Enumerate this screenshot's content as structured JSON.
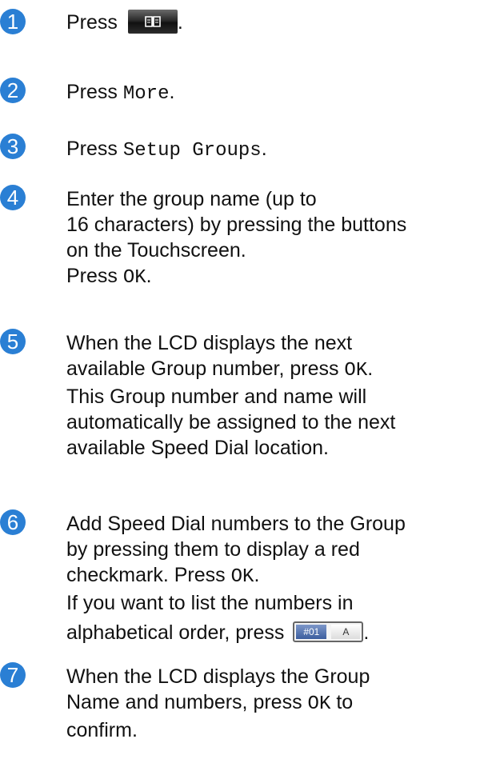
{
  "accent_color": "#2a7fd4",
  "steps": [
    {
      "number": "1",
      "press": "Press",
      "suffix": ".",
      "icon": "address-book-icon"
    },
    {
      "number": "2",
      "press": "Press",
      "code": "More",
      "suffix": "."
    },
    {
      "number": "3",
      "press": "Press",
      "code": "Setup Groups",
      "suffix": "."
    },
    {
      "number": "4",
      "lines": [
        "Enter the group name (up to",
        "16 characters) by pressing the buttons",
        "on the Touchscreen."
      ],
      "press": "Press",
      "code": "OK",
      "suffix": "."
    },
    {
      "number": "5",
      "line1": "When the LCD displays the next",
      "line2_pre": "available Group number, press",
      "line2_code": "OK",
      "line2_suffix": ".",
      "lines": [
        "This Group number and name will",
        "automatically be assigned to the next",
        "available Speed Dial location."
      ]
    },
    {
      "number": "6",
      "lines": [
        "Add Speed Dial numbers to the Group",
        "by pressing them to display a red"
      ],
      "line3_pre": "checkmark. Press",
      "line3_code": "OK",
      "line3_suffix": ".",
      "line4": "If you want to list the numbers in",
      "line5_pre": "alphabetical order, press",
      "line5_suffix": ".",
      "sort_button": {
        "left_label": "#01",
        "right_label": "A"
      }
    },
    {
      "number": "7",
      "line1": "When the LCD displays the Group",
      "line2_pre": "Name and numbers, press",
      "line2_code": "OK",
      "line2_post": "to",
      "line3": "confirm."
    }
  ]
}
